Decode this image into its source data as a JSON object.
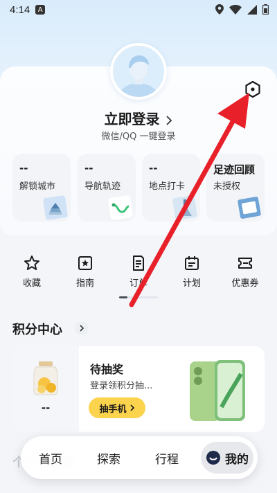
{
  "status_bar": {
    "time": "4:14",
    "badge": "A"
  },
  "profile": {
    "login_title": "立即登录",
    "login_subtitle": "微信/QQ  一键登录"
  },
  "stats": [
    {
      "value": "--",
      "label": "解锁城市"
    },
    {
      "value": "--",
      "label": "导航轨迹"
    },
    {
      "value": "--",
      "label": "地点打卡"
    },
    {
      "value": "足迹回顾",
      "label": "未授权"
    }
  ],
  "quick_actions": [
    {
      "label": "收藏",
      "icon": "star-icon"
    },
    {
      "label": "指南",
      "icon": "star-box-icon"
    },
    {
      "label": "订单",
      "icon": "order-icon"
    },
    {
      "label": "计划",
      "icon": "calendar-icon"
    },
    {
      "label": "优惠券",
      "icon": "coupon-icon"
    }
  ],
  "points": {
    "title": "积分中心",
    "jar_value": "--",
    "lottery_title": "待抽奖",
    "lottery_desc": "登录领积分抽...",
    "lottery_button": "抽手机"
  },
  "section_hint": "个性化设置",
  "nav": {
    "items": [
      "首页",
      "探索",
      "行程",
      "我的"
    ],
    "active": "我的"
  },
  "colors": {
    "accent_yellow": "#fcd34d",
    "annotation_arrow": "#e8202a"
  }
}
